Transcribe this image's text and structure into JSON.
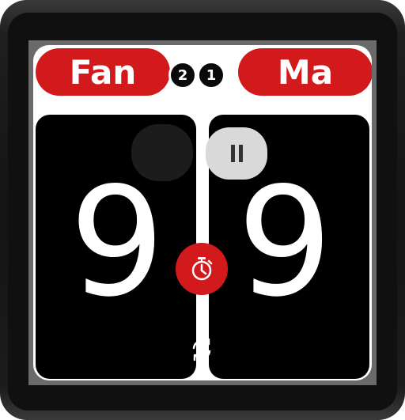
{
  "players": {
    "left_name": "Fan",
    "right_name": "Ma"
  },
  "sets": {
    "left": "2",
    "right": "1"
  },
  "scores": {
    "left": "9",
    "right": "9"
  },
  "icons": {
    "pause": "pause-icon",
    "timer": "stopwatch-icon",
    "swap": "swap-sides-icon"
  },
  "colors": {
    "accent": "#d21a1d",
    "panel": "#000000",
    "pause_button": "#d9d9d9"
  }
}
